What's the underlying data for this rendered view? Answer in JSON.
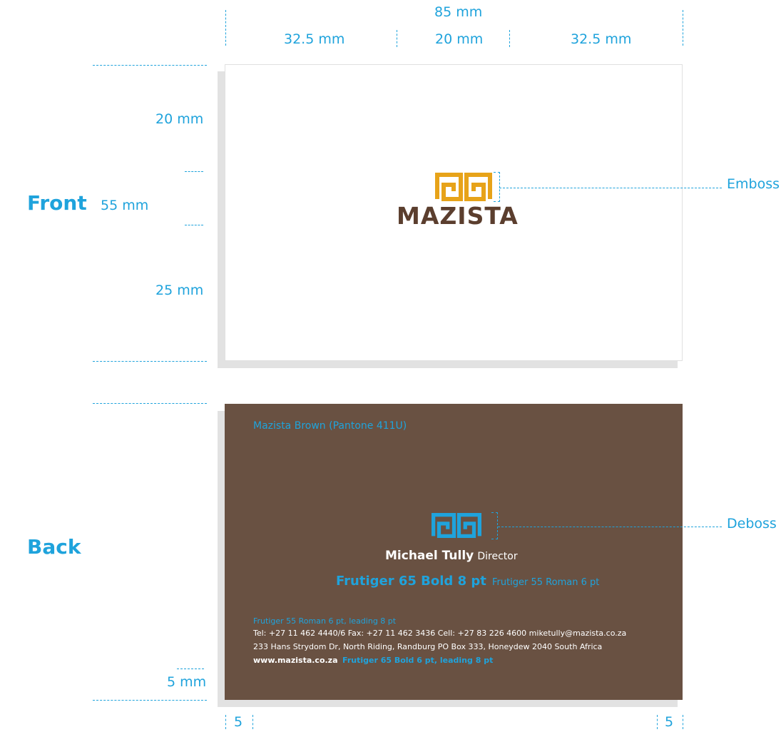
{
  "colors": {
    "accent": "#1fa3dc",
    "mazista_brown": "#695142",
    "logo_gold": "#e7a319",
    "logo_text_brown": "#5b3e2e"
  },
  "dimensions": {
    "total_width": "85 mm",
    "left_margin": "32.5 mm",
    "logo_width": "20 mm",
    "right_margin": "32.5 mm",
    "top_margin": "20 mm",
    "card_height": "55 mm",
    "bottom_margin": "25 mm",
    "back_bottom_margin": "5 mm",
    "back_left_margin": "5",
    "back_right_margin": "5"
  },
  "front": {
    "side_label": "Front",
    "brand_name": "MAZISTA",
    "callout": "Emboss"
  },
  "back": {
    "side_label": "Back",
    "color_note": "Mazista Brown (Pantone 411U)",
    "callout": "Deboss",
    "name": "Michael Tully",
    "title": "Director",
    "name_font_note": "Frutiger 65 Bold 8 pt",
    "title_font_note": "Frutiger 55 Roman 6 pt",
    "contact_font_note": "Frutiger 55 Roman 6 pt, leading 8 pt",
    "contact_line1": "Tel: +27 11 462 4440/6   Fax: +27 11 462 3436   Cell: +27 83 226 4600   miketully@mazista.co.za",
    "contact_line2": "233 Hans Strydom Dr, North Riding, Randburg   PO Box 333, Honeydew 2040 South Africa",
    "website": "www.mazista.co.za",
    "website_font_note": "Frutiger 65 Bold 6 pt, leading 8 pt"
  }
}
